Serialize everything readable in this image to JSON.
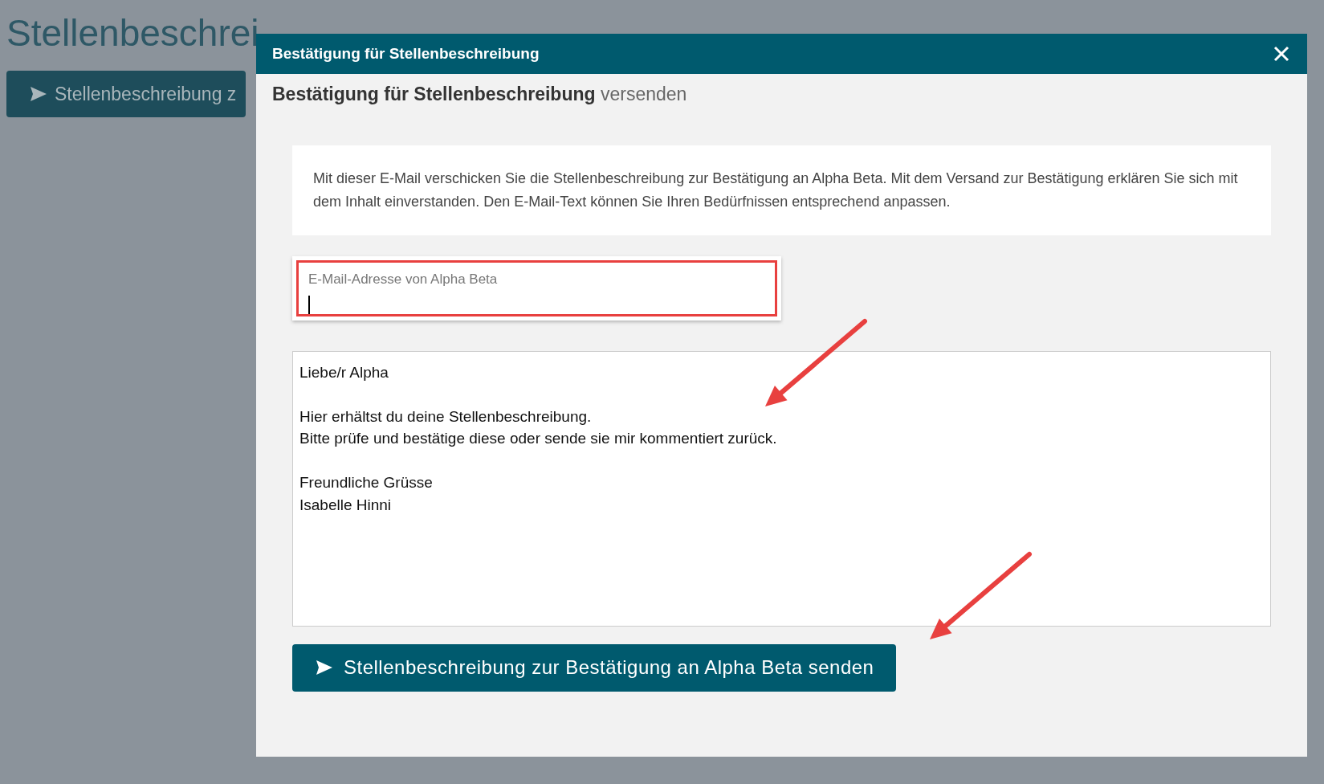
{
  "page": {
    "title": "Stellenbeschrei",
    "action_button": "Stellenbeschreibung z"
  },
  "dialog": {
    "title": "Bestätigung für Stellenbeschreibung",
    "heading_bold": "Bestätigung für Stellenbeschreibung",
    "heading_rest": "versenden",
    "info": "Mit dieser E-Mail verschicken Sie die Stellenbeschreibung zur Bestätigung an Alpha Beta. Mit dem Versand zur Bestätigung erklären Sie sich mit dem Inhalt einverstanden. Den E-Mail-Text können Sie Ihren Bedürfnissen entsprechend anpassen.",
    "email_field": {
      "label": "E-Mail-Adresse von Alpha Beta",
      "focused": true
    },
    "message": "Liebe/r Alpha\n\nHier erhältst du deine Stellenbeschreibung.\nBitte prüfe und bestätige diese oder sende sie mir kommentiert zurück.\n\nFreundliche Grüsse\nIsabelle Hinni",
    "send_button": "Stellenbeschreibung zur Bestätigung an Alpha Beta senden"
  }
}
